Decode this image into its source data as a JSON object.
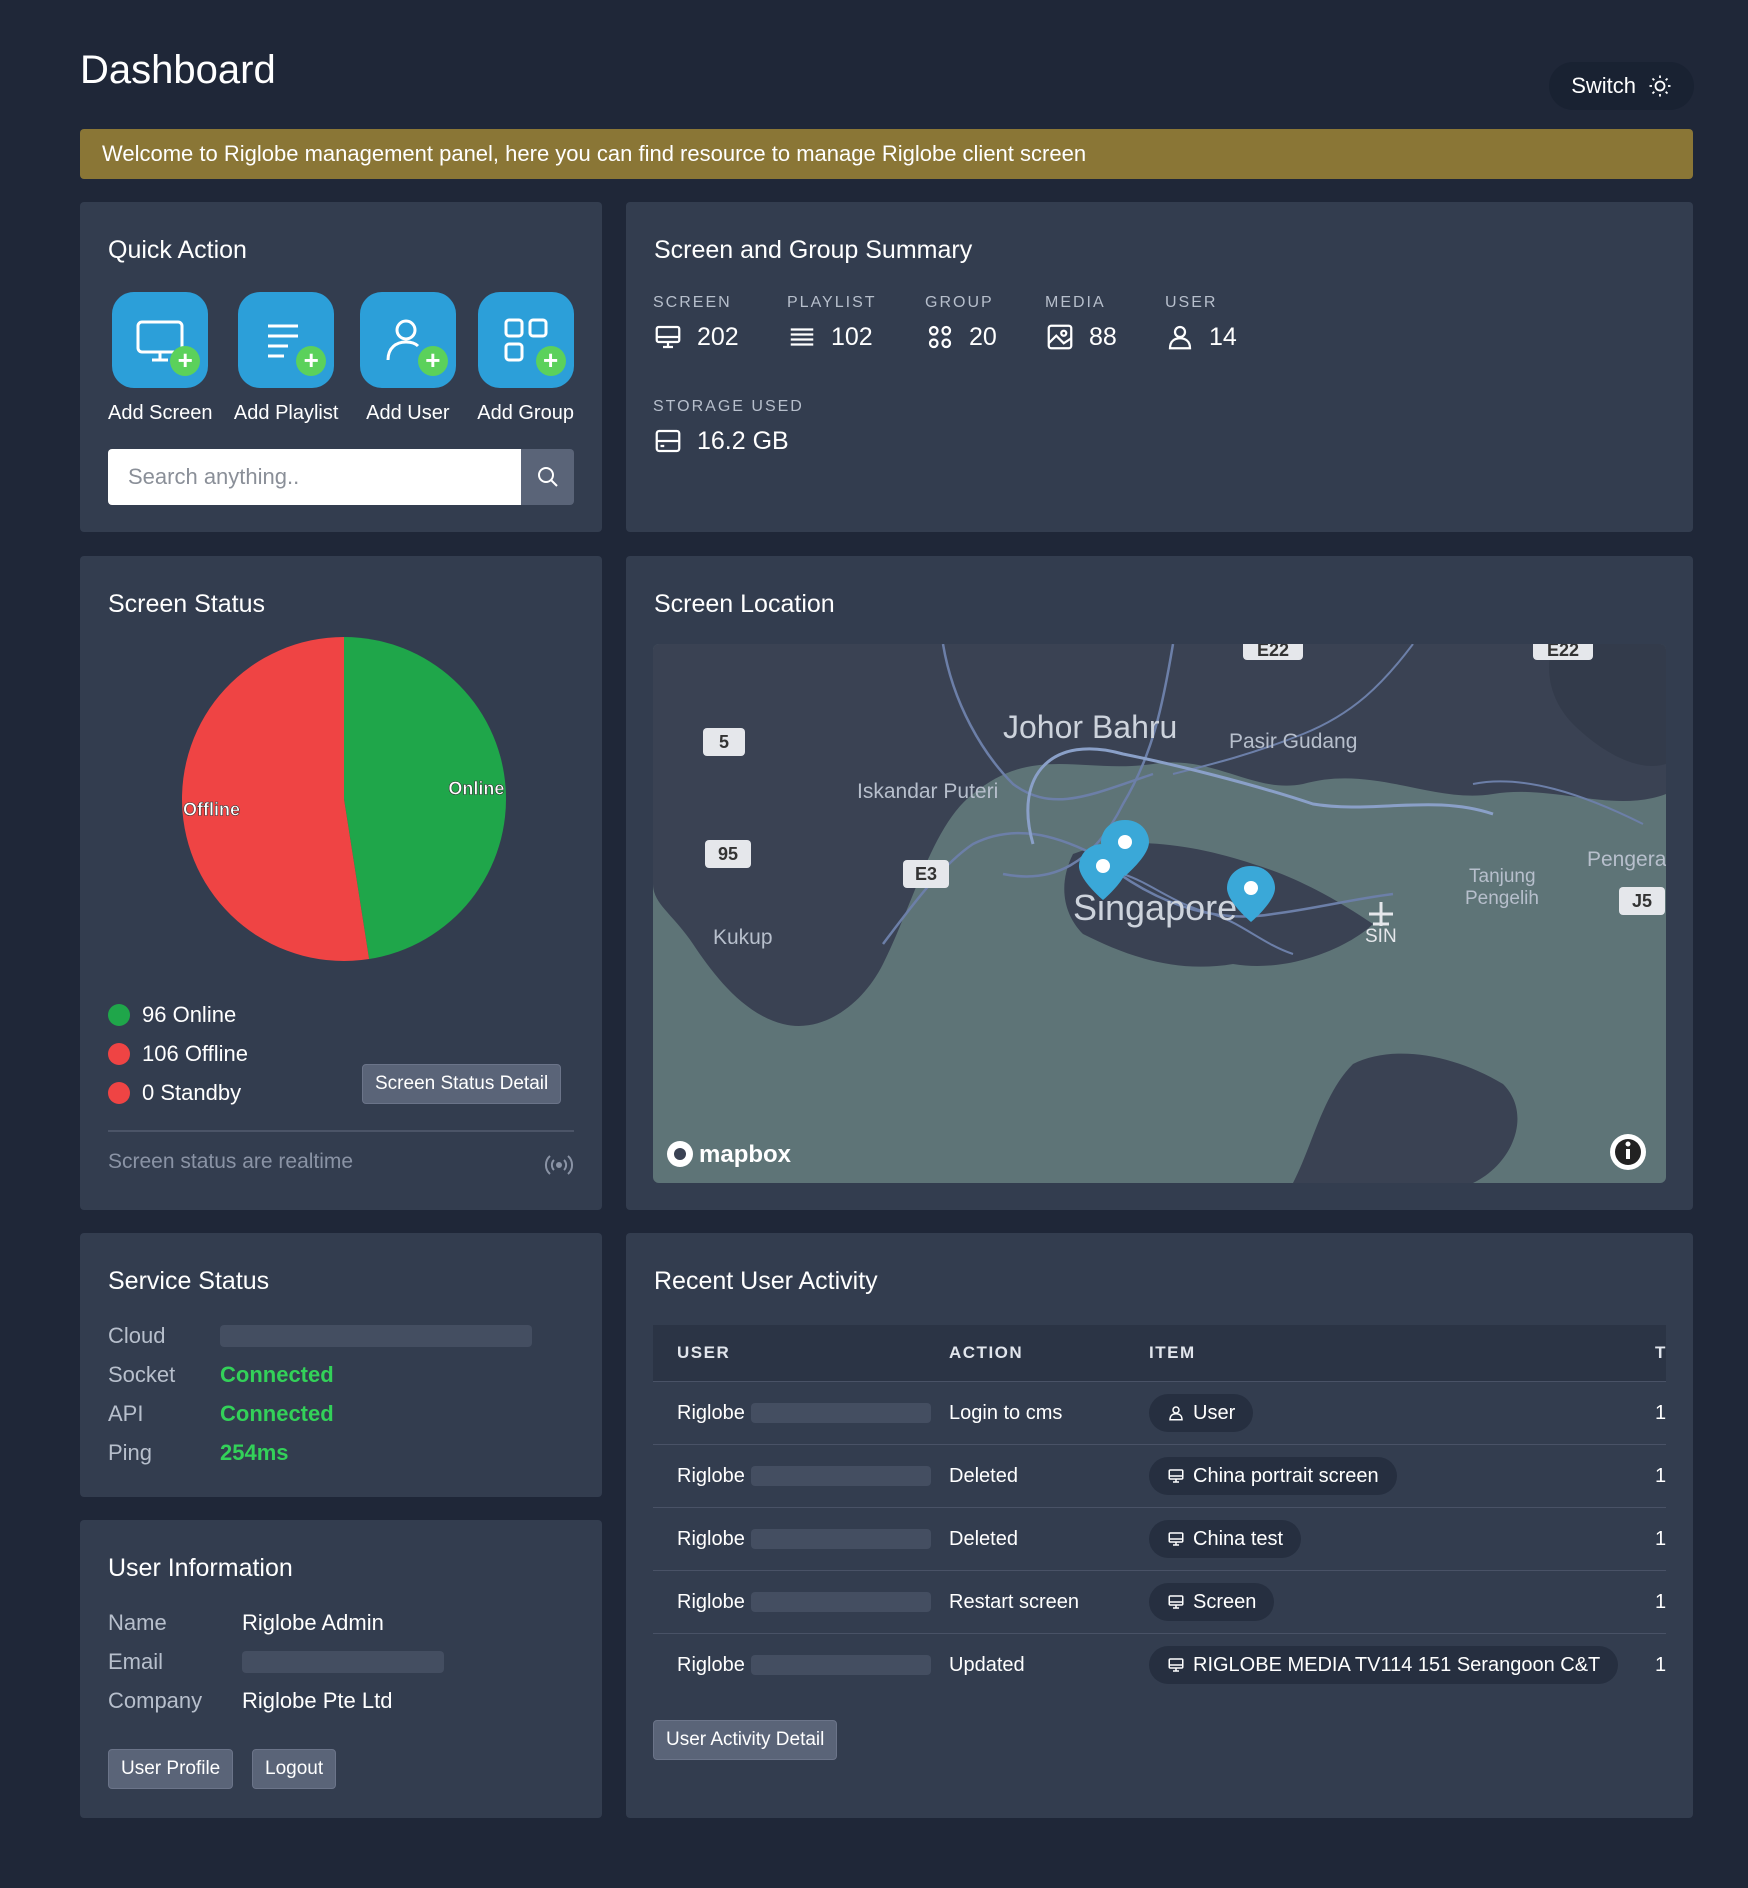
{
  "header": {
    "title": "Dashboard",
    "switch_label": "Switch"
  },
  "banner": {
    "text": "Welcome to Riglobe management panel, here you can find resource to manage Riglobe client screen"
  },
  "quick_action": {
    "title": "Quick Action",
    "items": [
      {
        "label": "Add Screen",
        "icon": "monitor-plus-icon"
      },
      {
        "label": "Add Playlist",
        "icon": "playlist-plus-icon"
      },
      {
        "label": "Add User",
        "icon": "user-plus-icon"
      },
      {
        "label": "Add Group",
        "icon": "grid-plus-icon"
      }
    ],
    "search_placeholder": "Search anything.."
  },
  "summary": {
    "title": "Screen and Group Summary",
    "stats": [
      {
        "label": "SCREEN",
        "value": "202",
        "icon": "monitor-icon"
      },
      {
        "label": "PLAYLIST",
        "value": "102",
        "icon": "list-icon"
      },
      {
        "label": "GROUP",
        "value": "20",
        "icon": "grid-icon"
      },
      {
        "label": "MEDIA",
        "value": "88",
        "icon": "image-icon"
      },
      {
        "label": "USER",
        "value": "14",
        "icon": "user-icon"
      }
    ],
    "storage": {
      "label": "STORAGE USED",
      "value": "16.2 GB",
      "icon": "storage-icon"
    }
  },
  "screen_status": {
    "title": "Screen Status",
    "legend": [
      {
        "text": "96 Online",
        "color": "#1fa64a"
      },
      {
        "text": "106 Offline",
        "color": "#ef4444"
      },
      {
        "text": "0 Standby",
        "color": "#ef4444"
      }
    ],
    "detail_button": "Screen Status Detail",
    "footer": "Screen status are realtime"
  },
  "chart_data": {
    "type": "pie",
    "categories": [
      "Online",
      "Offline"
    ],
    "values": [
      96,
      106
    ],
    "colors": [
      "#1fa64a",
      "#ef4444"
    ]
  },
  "location": {
    "title": "Screen Location",
    "labels": {
      "johor": "Johor Bahru",
      "pasir": "Pasir Gudang",
      "iskandar": "Iskandar Puteri",
      "singapore": "Singapore",
      "kukup": "Kukup",
      "tanjung1": "Tanjung",
      "tanjung2": "Pengelih",
      "pengera": "Pengera",
      "sin": "SIN",
      "r5": "5",
      "r95": "95",
      "re3": "E3",
      "rj5": "J5",
      "re22a": "E22",
      "re22b": "E22"
    },
    "attribution": "mapbox"
  },
  "service_status": {
    "title": "Service Status",
    "rows": [
      {
        "key": "Cloud",
        "value": ""
      },
      {
        "key": "Socket",
        "value": "Connected"
      },
      {
        "key": "API",
        "value": "Connected"
      },
      {
        "key": "Ping",
        "value": "254ms"
      }
    ]
  },
  "user_info": {
    "title": "User Information",
    "rows": [
      {
        "key": "Name",
        "value": "Riglobe Admin"
      },
      {
        "key": "Email",
        "value": ""
      },
      {
        "key": "Company",
        "value": "Riglobe Pte Ltd"
      }
    ],
    "profile_button": "User Profile",
    "logout_button": "Logout"
  },
  "activity": {
    "title": "Recent User Activity",
    "columns": [
      "USER",
      "ACTION",
      "ITEM",
      "T"
    ],
    "rows": [
      {
        "user": "Riglobe",
        "action": "Login to cms",
        "item": "User",
        "item_icon": "user-icon",
        "t": "1"
      },
      {
        "user": "Riglobe",
        "action": "Deleted",
        "item": "China portrait screen",
        "item_icon": "monitor-icon",
        "t": "1"
      },
      {
        "user": "Riglobe",
        "action": "Deleted",
        "item": "China test",
        "item_icon": "monitor-icon",
        "t": "1"
      },
      {
        "user": "Riglobe",
        "action": "Restart screen",
        "item": "Screen",
        "item_icon": "monitor-icon",
        "t": "1"
      },
      {
        "user": "Riglobe",
        "action": "Updated",
        "item": "RIGLOBE MEDIA TV114 151 Serangoon C&T",
        "item_icon": "monitor-icon",
        "t": "1"
      }
    ],
    "detail_button": "User Activity Detail"
  }
}
